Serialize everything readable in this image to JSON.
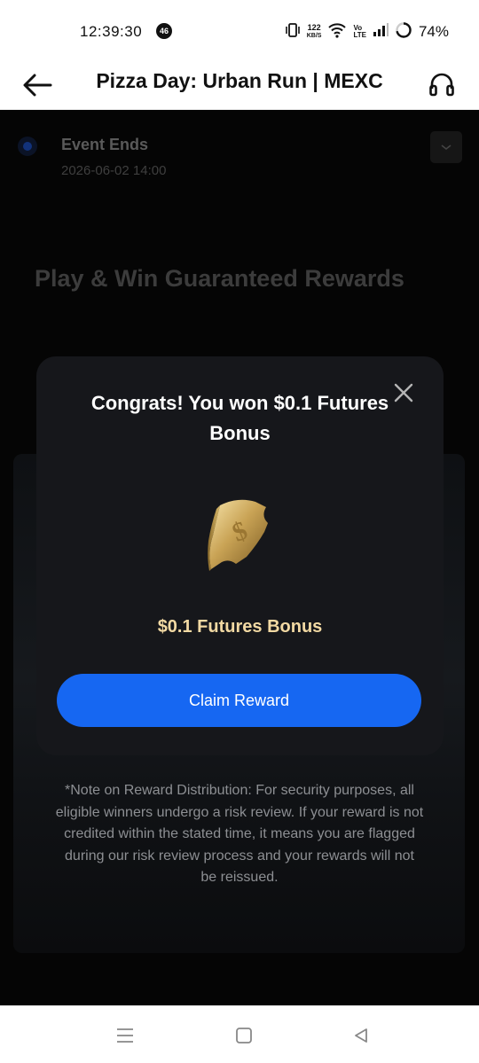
{
  "status_bar": {
    "time": "12:39:30",
    "notification_count": "46",
    "net_speed_value": "122",
    "net_speed_unit": "KB/S",
    "volte_top": "Vo",
    "volte_bottom": "LTE",
    "battery": "74%"
  },
  "header": {
    "title": "Pizza Day: Urban Run | MEXC"
  },
  "event": {
    "label": "Event Ends",
    "date": "2026-06-02 14:00"
  },
  "page": {
    "headline": "Play & Win Guaranteed Rewards",
    "note": "*Note on Reward Distribution: For security purposes, all eligible winners undergo a risk review. If your reward is not credited within the stated time, it means you are flagged during our risk review process and your rewards will not be reissued."
  },
  "modal": {
    "title": "Congrats! You won $0.1 Futures Bonus",
    "reward_name": "$0.1 Futures Bonus",
    "claim_label": "Claim Reward",
    "reward_icon": "gold-ticket-icon"
  },
  "colors": {
    "accent": "#1667f2",
    "reward_text": "#f2d9a3",
    "modal_bg": "#16171b"
  }
}
